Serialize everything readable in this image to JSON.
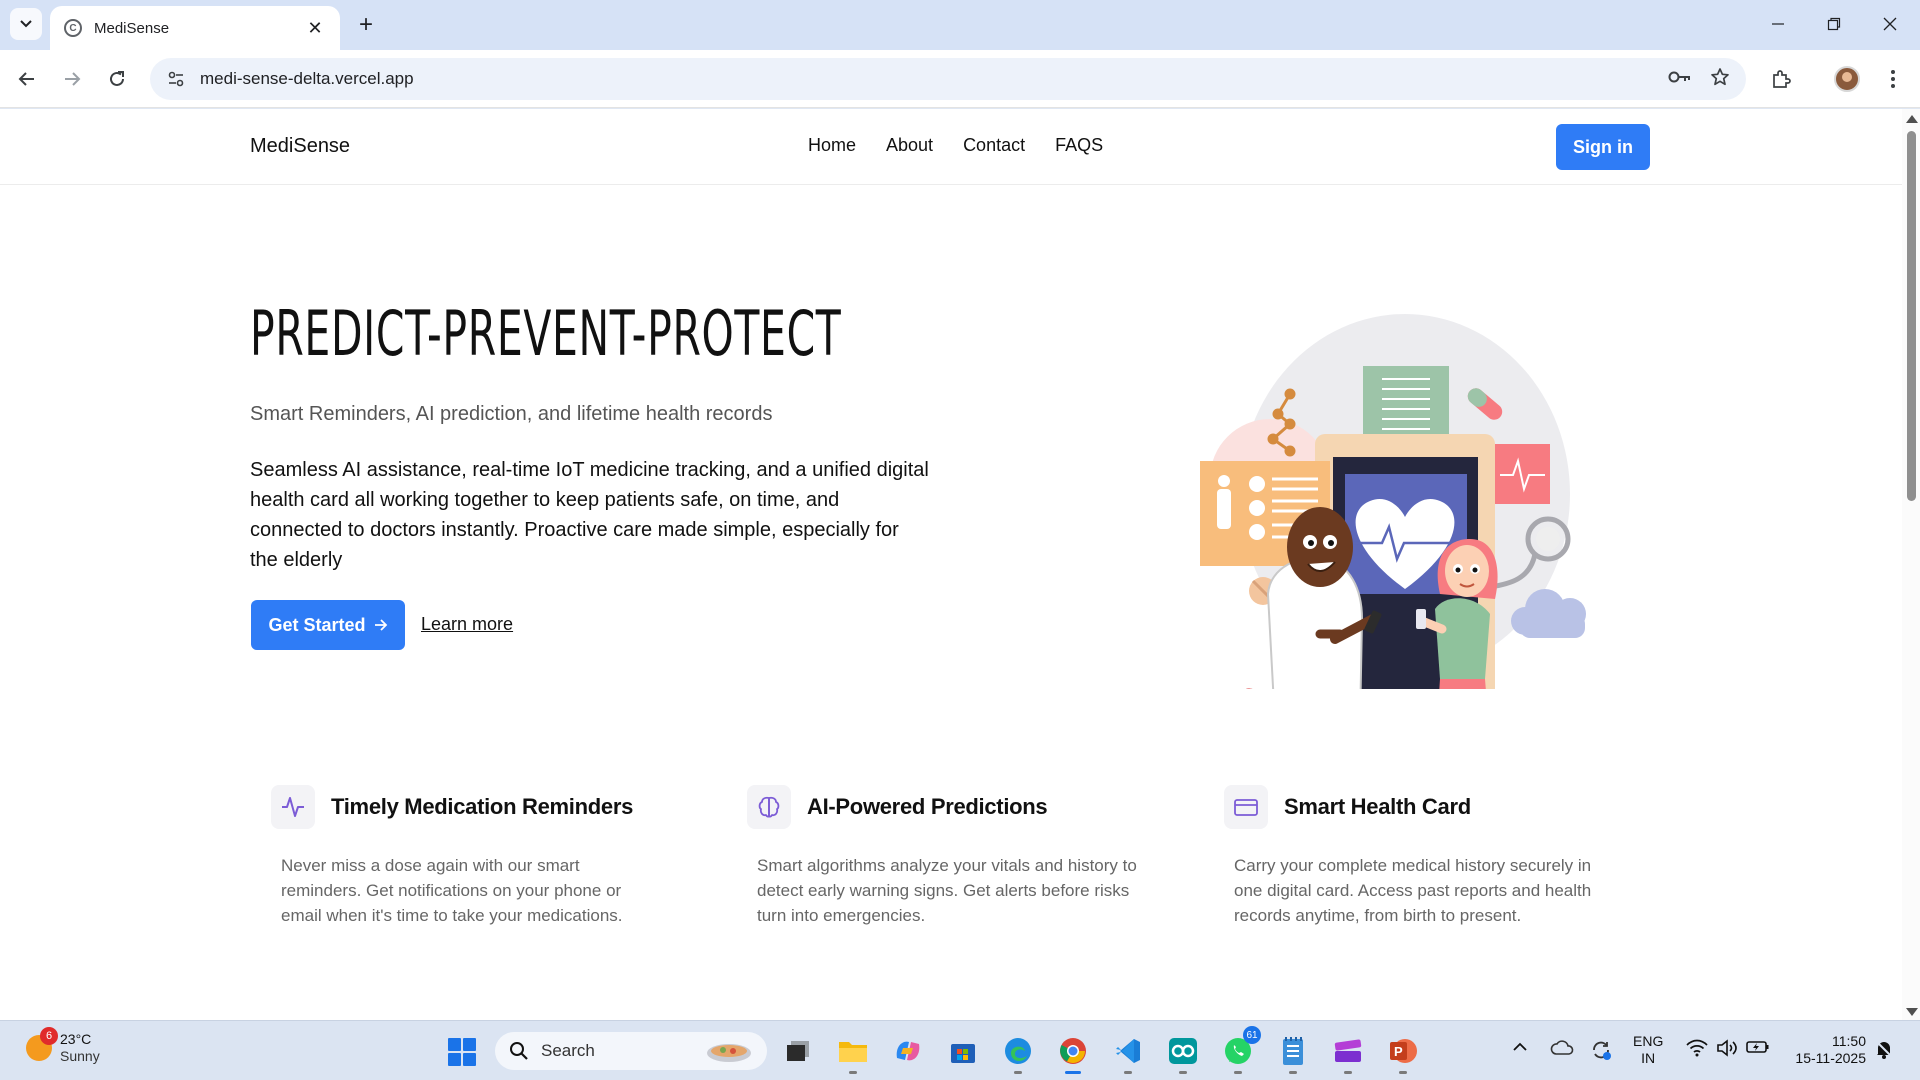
{
  "browser": {
    "tab_title": "MediSense",
    "url": "medi-sense-delta.vercel.app"
  },
  "site": {
    "brand": "MediSense",
    "nav": [
      "Home",
      "About",
      "Contact",
      "FAQS"
    ],
    "signin": "Sign in",
    "hero": {
      "title": "PREDICT-PREVENT-PROTECT",
      "subtitle": "Smart Reminders, AI prediction, and lifetime health records",
      "description": "Seamless AI assistance, real-time IoT medicine tracking, and a unified digital health card all working together to keep patients safe, on time, and connected to doctors instantly. Proactive care made simple, especially for the elderly",
      "cta": "Get Started",
      "learn_more": "Learn more"
    },
    "features": [
      {
        "icon": "activity-icon",
        "title": "Timely Medication Reminders",
        "desc": "Never miss a dose again with our smart reminders. Get notifications on your phone or email when it's time to take your medications."
      },
      {
        "icon": "brain-icon",
        "title": "AI-Powered Predictions",
        "desc": "Smart algorithms analyze your vitals and history to detect early warning signs. Get alerts before risks turn into emergencies."
      },
      {
        "icon": "card-icon",
        "title": "Smart Health Card",
        "desc": "Carry your complete medical history securely in one digital card. Access past reports and health records anytime, from birth to present."
      }
    ],
    "accent_color": "#2f7cf6",
    "icon_color": "#7c5cd6"
  },
  "taskbar": {
    "weather_temp": "23°C",
    "weather_cond": "Sunny",
    "weather_badge": "6",
    "search_placeholder": "Search",
    "whatsapp_badge": "61",
    "lang_top": "ENG",
    "lang_bottom": "IN",
    "time": "11:50",
    "date": "15-11-2025"
  }
}
